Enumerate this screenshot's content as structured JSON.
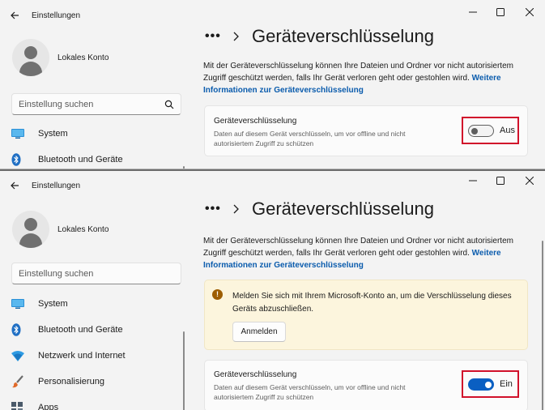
{
  "window_top": {
    "app_title": "Einstellungen",
    "account_name": "Lokales Konto",
    "search_placeholder": "Einstellung suchen",
    "nav": [
      {
        "label": "System",
        "icon": "monitor-icon"
      },
      {
        "label": "Bluetooth und Geräte",
        "icon": "bluetooth-icon"
      }
    ],
    "breadcrumb_dots": "•••",
    "page_title": "Geräteverschlüsselung",
    "description": "Mit der Geräteverschlüsselung können Ihre Dateien und Ordner vor nicht autorisiertem Zugriff geschützt werden, falls Ihr Gerät verloren geht oder gestohlen wird.",
    "link": "Weitere Informationen zur Geräteverschlüsselung",
    "card": {
      "title": "Geräteverschlüsselung",
      "description": "Daten auf diesem Gerät verschlüsseln, um vor offline und nicht autorisiertem Zugriff zu schützen",
      "toggle_label": "Aus",
      "toggle_on": false
    }
  },
  "window_bottom": {
    "app_title": "Einstellungen",
    "account_name": "Lokales Konto",
    "search_placeholder": "Einstellung suchen",
    "nav": [
      {
        "label": "System",
        "icon": "monitor-icon"
      },
      {
        "label": "Bluetooth und Geräte",
        "icon": "bluetooth-icon"
      },
      {
        "label": "Netzwerk und Internet",
        "icon": "network-icon"
      },
      {
        "label": "Personalisierung",
        "icon": "brush-icon"
      },
      {
        "label": "Apps",
        "icon": "apps-icon"
      }
    ],
    "breadcrumb_dots": "•••",
    "page_title": "Geräteverschlüsselung",
    "description": "Mit der Geräteverschlüsselung können Ihre Dateien und Ordner vor nicht autorisiertem Zugriff geschützt werden, falls Ihr Gerät verloren geht oder gestohlen wird.",
    "link": "Weitere Informationen zur Geräteverschlüsselung",
    "warning": {
      "text": "Melden Sie sich mit Ihrem Microsoft-Konto an, um die Verschlüsselung dieses Geräts abzuschließen.",
      "button": "Anmelden"
    },
    "card": {
      "title": "Geräteverschlüsselung",
      "description": "Daten auf diesem Gerät verschlüsseln, um vor offline und nicht autorisiertem Zugriff zu schützen",
      "toggle_label": "Ein",
      "toggle_on": true
    }
  },
  "colors": {
    "accent": "#0a5fc2",
    "highlight_box": "#d1112b",
    "warning_bg": "#fcf5dd",
    "link": "#0b5cad"
  }
}
